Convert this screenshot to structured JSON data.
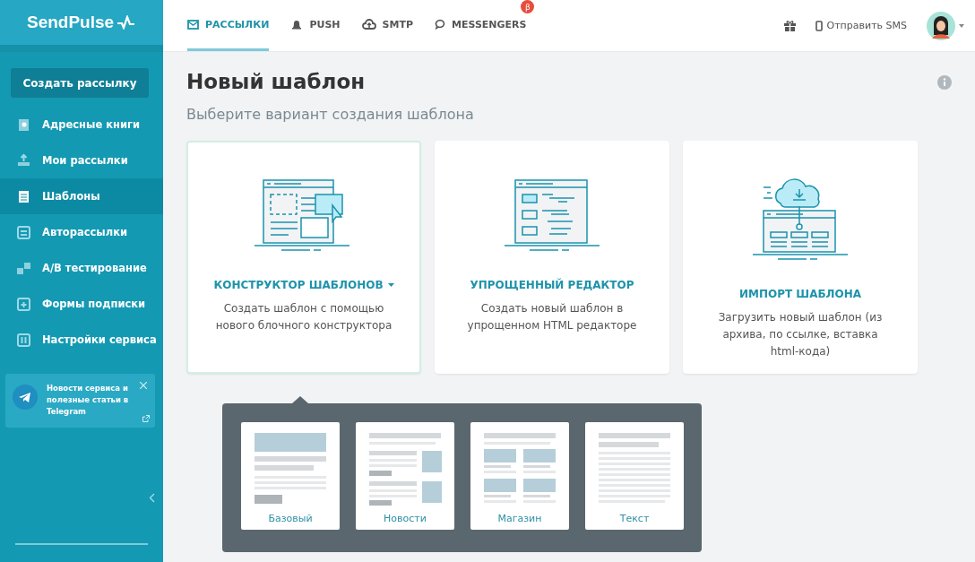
{
  "logo": {
    "text": "SendPulse"
  },
  "nav": {
    "tabs": [
      {
        "label": "РАССЫЛКИ",
        "selected": true
      },
      {
        "label": "PUSH",
        "selected": false
      },
      {
        "label": "SMTP",
        "selected": false
      },
      {
        "label": "MESSENGERS",
        "selected": false,
        "badge": "β"
      }
    ],
    "sms_link": "Отправить SMS"
  },
  "sidebar": {
    "create_button": "Создать рассылку",
    "items": [
      {
        "label": "Адресные книги",
        "selected": false
      },
      {
        "label": "Мои рассылки",
        "selected": false
      },
      {
        "label": "Шаблоны",
        "selected": true
      },
      {
        "label": "Авторассылки",
        "selected": false
      },
      {
        "label": "A/B тестирование",
        "selected": false
      },
      {
        "label": "Формы подписки",
        "selected": false
      },
      {
        "label": "Настройки сервиса",
        "selected": false
      }
    ],
    "promo": {
      "text": "Новости сервиса и полезные статьи в Telegram"
    }
  },
  "page": {
    "title": "Новый шаблон",
    "subtitle": "Выберите вариант создания шаблона"
  },
  "cards": [
    {
      "kind": "builder",
      "title": "КОНСТРУКТОР ШАБЛОНОВ",
      "dropdown": true,
      "selected": true,
      "description": "Создать шаблон с помощью нового блочного конструктора"
    },
    {
      "kind": "editor",
      "title": "УПРОЩЕННЫЙ РЕДАКТОР",
      "dropdown": false,
      "selected": false,
      "description": "Создать новый шаблон в упрощенном HTML редакторе"
    },
    {
      "kind": "import",
      "title": "ИМПОРТ ШАБЛОНА",
      "dropdown": false,
      "selected": false,
      "description": "Загрузить новый шаблон (из архива, по ссылке, вставка html-кода)"
    }
  ],
  "templates": [
    {
      "kind": "basic",
      "label": "Базовый"
    },
    {
      "kind": "news",
      "label": "Новости"
    },
    {
      "kind": "shop",
      "label": "Магазин"
    },
    {
      "kind": "text",
      "label": "Текст"
    }
  ]
}
